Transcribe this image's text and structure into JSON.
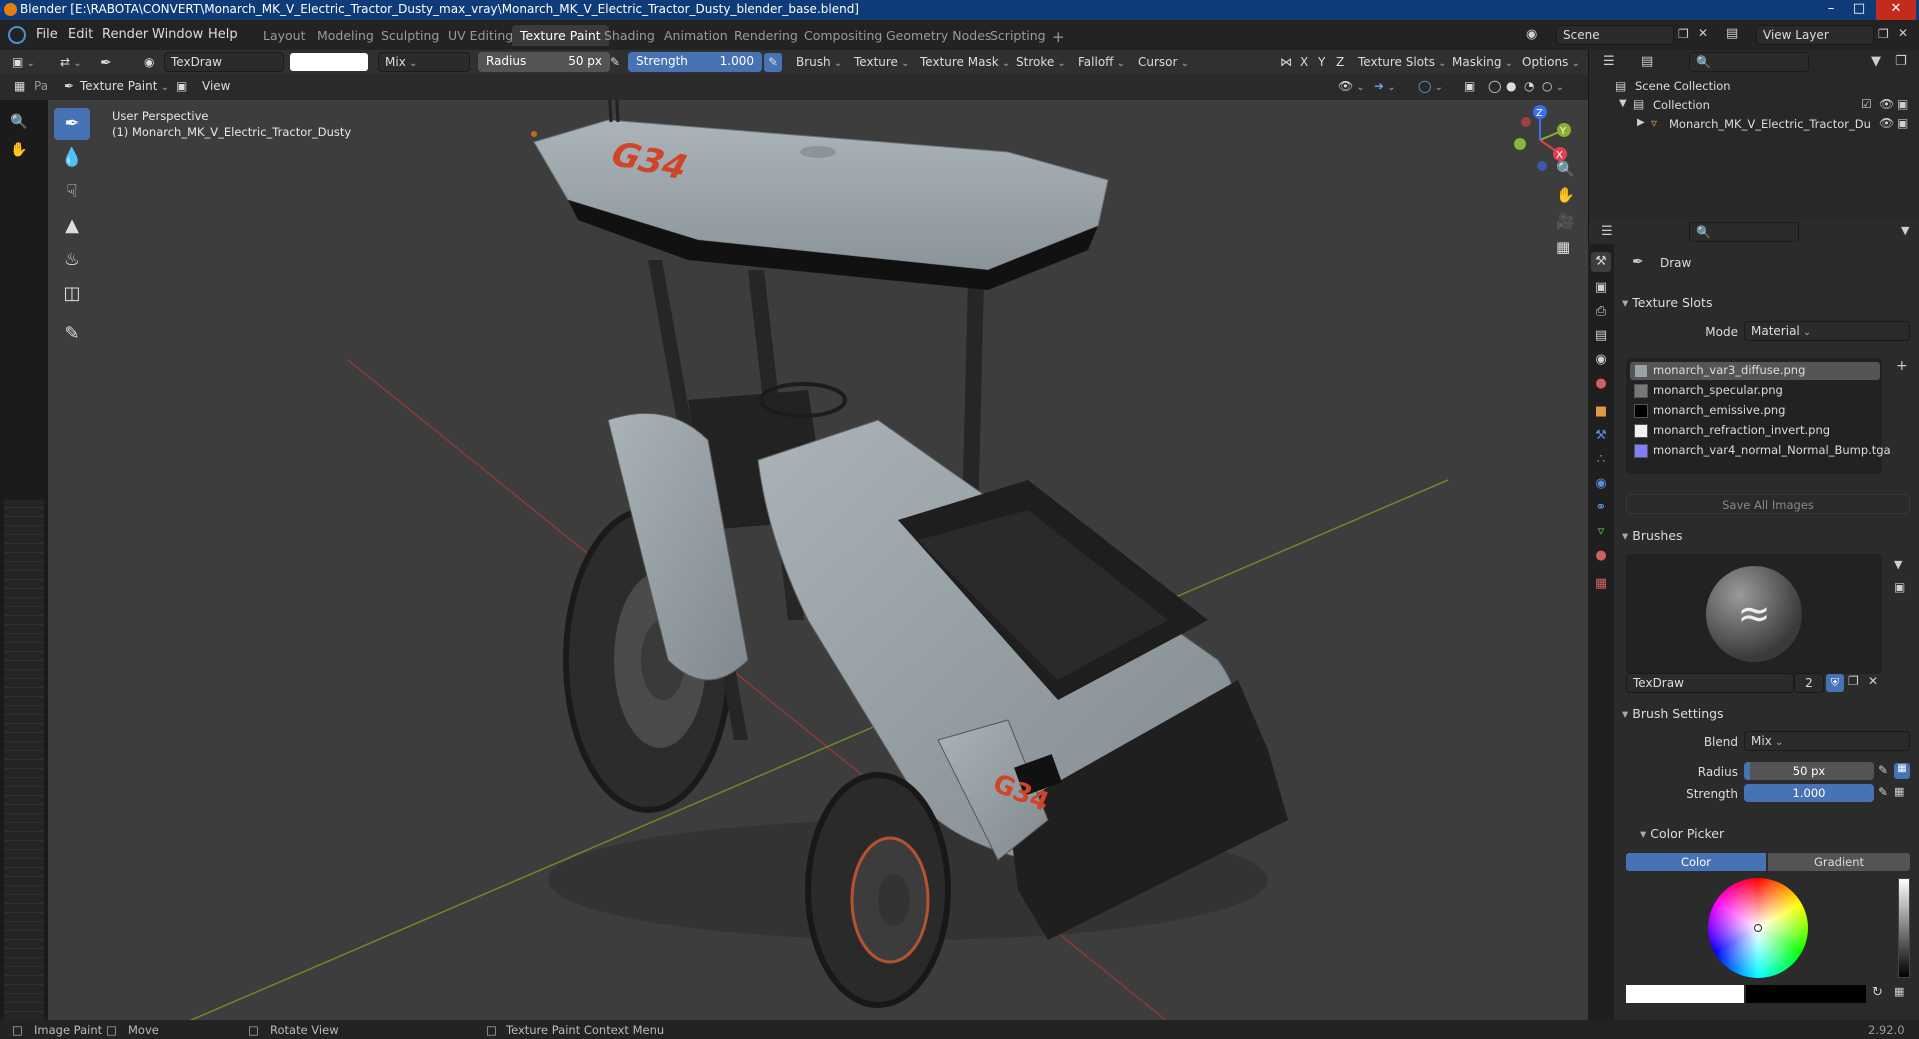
{
  "window": {
    "title": "Blender [E:\\RABOTA\\CONVERT\\Monarch_MK_V_Electric_Tractor_Dusty_max_vray\\Monarch_MK_V_Electric_Tractor_Dusty_blender_base.blend]"
  },
  "menu": [
    "File",
    "Edit",
    "Render",
    "Window",
    "Help"
  ],
  "workspaces": [
    "Layout",
    "Modeling",
    "Sculpting",
    "UV Editing",
    "Texture Paint",
    "Shading",
    "Animation",
    "Rendering",
    "Compositing",
    "Geometry Nodes",
    "Scripting"
  ],
  "workspace_active": "Texture Paint",
  "scene": {
    "name": "Scene",
    "view_layer": "View Layer"
  },
  "header": {
    "brush_name": "TexDraw",
    "blend": "Mix",
    "radius_label": "Radius",
    "radius_value": "50 px",
    "strength_label": "Strength",
    "strength_value": "1.000",
    "menus": [
      "Brush",
      "Texture",
      "Texture Mask",
      "Stroke",
      "Falloff",
      "Cursor"
    ],
    "axes": [
      "X",
      "Y",
      "Z"
    ],
    "right_menus": [
      "Texture Slots",
      "Masking",
      "Options"
    ]
  },
  "subheader": {
    "mode": "Texture Paint",
    "view": "View"
  },
  "viewport": {
    "perspective": "User Perspective",
    "object": "(1) Monarch_MK_V_Electric_Tractor_Dusty",
    "decal_text": "G34"
  },
  "outliner": {
    "scene_collection": "Scene Collection",
    "collection": "Collection",
    "object": "Monarch_MK_V_Electric_Tractor_Du"
  },
  "properties": {
    "tool_name": "Draw",
    "texture_slots_title": "Texture Slots",
    "mode_label": "Mode",
    "mode_value": "Material",
    "slots": [
      {
        "name": "monarch_var3_diffuse.png",
        "swatch": "#9aa2a6"
      },
      {
        "name": "monarch_specular.png",
        "swatch": "#777777"
      },
      {
        "name": "monarch_emissive.png",
        "swatch": "#000000"
      },
      {
        "name": "monarch_refraction_invert.png",
        "swatch": "#f2f2f2"
      },
      {
        "name": "monarch_var4_normal_Normal_Bump.tga",
        "swatch": "#8080ff"
      }
    ],
    "save_all": "Save All Images",
    "brushes_title": "Brushes",
    "brush_name": "TexDraw",
    "brush_users": "2",
    "brush_settings_title": "Brush Settings",
    "blend_label": "Blend",
    "blend_value": "Mix",
    "radius_label": "Radius",
    "radius_value": "50 px",
    "strength_label": "Strength",
    "strength_value": "1.000",
    "color_picker_title": "Color Picker",
    "color_tab": "Color",
    "gradient_tab": "Gradient"
  },
  "statusbar": {
    "image_paint": "Image Paint",
    "move": "Move",
    "rotate_view": "Rotate View",
    "context_menu": "Texture Paint Context Menu",
    "version": "2.92.0"
  },
  "colors": {
    "accent": "#4772b3",
    "title_bar": "#0f3c78",
    "decal": "#d0452a"
  }
}
